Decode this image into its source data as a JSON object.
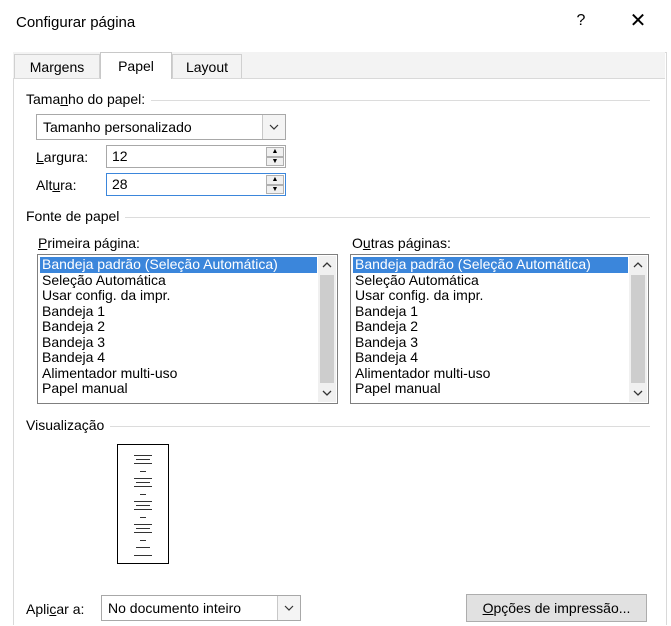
{
  "dialog": {
    "title": "Configurar página",
    "help_label": "?",
    "close_label": "✕"
  },
  "tabs": [
    {
      "label": "Margens",
      "active": false
    },
    {
      "label": "Papel",
      "active": true
    },
    {
      "label": "Layout",
      "active": false
    }
  ],
  "paper_size": {
    "group_label_pre": "Tama",
    "group_label_key": "n",
    "group_label_post": "ho do papel:",
    "selected": "Tamanho personalizado",
    "width_label_key": "L",
    "width_label_post": "argura:",
    "width_value": "12",
    "height_label_pre": "Alt",
    "height_label_key": "u",
    "height_label_post": "ra:",
    "height_value": "28"
  },
  "paper_source": {
    "group_label": "Fonte de papel",
    "first_page_label_key": "P",
    "first_page_label_post": "rimeira página:",
    "other_pages_label_pre": "O",
    "other_pages_label_key": "u",
    "other_pages_label_post": "tras páginas:",
    "first_page_items": [
      "Bandeja padrão (Seleção Automática)",
      "Seleção Automática",
      "Usar config. da impr.",
      "Bandeja 1",
      "Bandeja 2",
      "Bandeja 3",
      "Bandeja 4",
      "Alimentador multi-uso",
      "Papel manual"
    ],
    "other_pages_items": [
      "Bandeja padrão (Seleção Automática)",
      "Seleção Automática",
      "Usar config. da impr.",
      "Bandeja 1",
      "Bandeja 2",
      "Bandeja 3",
      "Bandeja 4",
      "Alimentador multi-uso",
      "Papel manual"
    ],
    "selected_index": 0
  },
  "preview": {
    "group_label": "Visualização"
  },
  "footer": {
    "apply_label_pre": "Apli",
    "apply_label_key": "c",
    "apply_label_post": "ar a:",
    "apply_value": "No documento inteiro",
    "print_options_key": "O",
    "print_options_post": "pções de impressão..."
  },
  "icons": {
    "dropdown": "chevron-down-icon",
    "spin_up": "triangle-up-icon",
    "spin_down": "triangle-down-icon",
    "scroll_up": "chevron-up-icon",
    "scroll_down": "chevron-down-icon",
    "close": "close-icon",
    "help": "help-icon"
  },
  "colors": {
    "selection": "#3b86db",
    "border": "#a8a8a8"
  }
}
